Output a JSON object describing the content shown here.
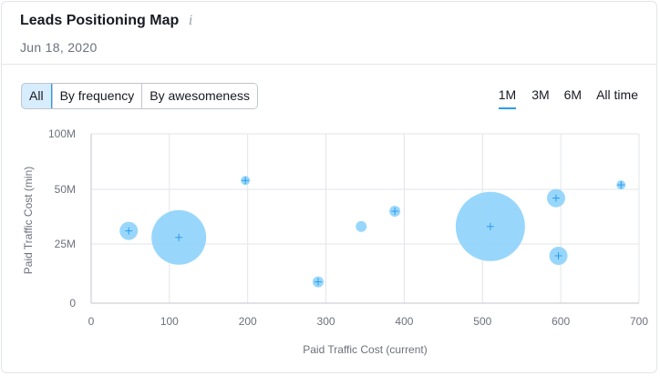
{
  "header": {
    "title": "Leads Positioning Map",
    "info_icon": "info-icon",
    "date": "Jun 18, 2020"
  },
  "filters": [
    {
      "label": "All",
      "active": true
    },
    {
      "label": "By frequency",
      "active": false
    },
    {
      "label": "By awesomeness",
      "active": false
    }
  ],
  "periods": [
    {
      "label": "1M",
      "active": true
    },
    {
      "label": "3M",
      "active": false
    },
    {
      "label": "6M",
      "active": false
    },
    {
      "label": "All time",
      "active": false
    }
  ],
  "colors": {
    "bubble": "#8dd3fb",
    "marker": "#2b9cf0",
    "grid": "#e3e5ea",
    "axis": "#c1c5cd"
  },
  "chart_data": {
    "type": "scatter",
    "xlabel": "Paid Traffic Cost (current)",
    "ylabel": "Paid Traffic Cost (min)",
    "x_ticks": [
      0,
      100,
      200,
      300,
      400,
      500,
      600,
      700
    ],
    "xlim": [
      0,
      700
    ],
    "y_ticks": [
      "0",
      "25M",
      "50M",
      "100M"
    ],
    "y_scale": "categorical-spaced",
    "grid": true,
    "points": [
      {
        "x": 48,
        "y": "31M",
        "size": 10,
        "crosshair": true
      },
      {
        "x": 112,
        "y": "28M",
        "size": 30,
        "crosshair": true
      },
      {
        "x": 197,
        "y": "58M",
        "size": 5,
        "crosshair": true
      },
      {
        "x": 290,
        "y": "9M",
        "size": 6,
        "crosshair": true
      },
      {
        "x": 345,
        "y": "33M",
        "size": 6,
        "crosshair": false
      },
      {
        "x": 388,
        "y": "40M",
        "size": 6,
        "crosshair": true
      },
      {
        "x": 510,
        "y": "33M",
        "size": 38,
        "crosshair": true
      },
      {
        "x": 594,
        "y": "46M",
        "size": 10,
        "crosshair": true
      },
      {
        "x": 597,
        "y": "20M",
        "size": 10,
        "crosshair": true
      },
      {
        "x": 677,
        "y": "54M",
        "size": 5,
        "crosshair": true
      }
    ]
  }
}
